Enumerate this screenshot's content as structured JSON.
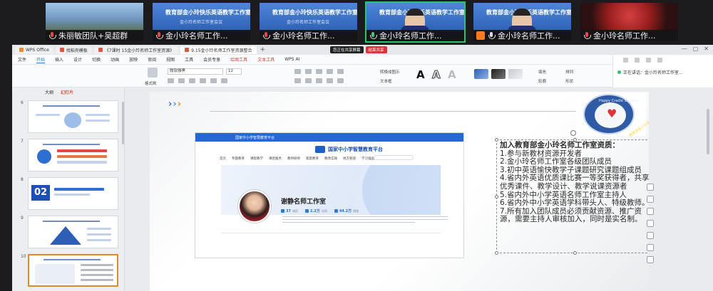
{
  "meeting": {
    "participants": [
      {
        "name": "朱丽敏团队+吴超群",
        "mic": "muted",
        "scene": "lake",
        "banner": "",
        "sub": ""
      },
      {
        "name": "金小玲名师工作...",
        "mic": "muted",
        "scene": "blue",
        "banner": "教育部金小玲快乐英语教学工作室",
        "sub": "金小玲名师工作室会议"
      },
      {
        "name": "金小玲名师工作...",
        "mic": "muted",
        "scene": "blue",
        "banner": "教育部金小玲快乐英语教学工作室",
        "sub": "金小玲名师工作室会议"
      },
      {
        "name": "金小玲名师工作...",
        "mic": "green",
        "scene": "blue",
        "banner": "教育部金小玲快乐英语教学工作室",
        "sub": "金小玲名师工作室会议"
      },
      {
        "name": "金小玲名师工作...",
        "mic": "normal",
        "scene": "blue",
        "banner": "教育部金小玲快乐英语教学工作室",
        "sub": "金小玲名师工作室会议"
      },
      {
        "name": "金小玲名师工作...",
        "mic": "muted",
        "scene": "flower",
        "banner": "",
        "sub": ""
      }
    ],
    "share_label": "您正在共享屏幕",
    "stop_label": "结束共享",
    "side_status": "正在讲话：金小玲名师工作室..."
  },
  "app": {
    "tabs": [
      {
        "label": "WPS Office",
        "kind": "o"
      },
      {
        "label": "找稻壳模板",
        "kind": "r"
      },
      {
        "label": "《7课时 15金小玲名师工作室资源》",
        "kind": "r"
      },
      {
        "label": "9.15金小玲名师工作室资源整合",
        "kind": "r"
      }
    ],
    "add_tab": "+",
    "menus": [
      "文件",
      "开始",
      "插入",
      "设计",
      "切换",
      "动画",
      "放映",
      "审阅",
      "视图",
      "工具",
      "会员专享",
      "绘图工具",
      "文本工具",
      "WPS AI"
    ],
    "active_menu": "开始",
    "ribbon": {
      "font_name": "微软雅黑",
      "font_size": "12",
      "format_painter": "格式刷",
      "convert_smartart": "转换成图示",
      "text_box": "文本框",
      "arrange": "排列",
      "shape": "形状",
      "fill": "填充",
      "outline": "轮廓"
    }
  },
  "thumbnails": {
    "header_label": "大纲",
    "header_brand": "幻灯片",
    "items": [
      {
        "num": "6"
      },
      {
        "num": "7"
      },
      {
        "num": "8"
      },
      {
        "num": "9"
      },
      {
        "num": "10"
      }
    ],
    "slide9_number": "02"
  },
  "slide": {
    "arrow_glyphs": [
      "›",
      "›",
      "›"
    ],
    "logo_ring_text": "Happy Cradle Success",
    "logo_ring_text2": "教育部金小玲名师工作室",
    "logo_heart": "♥",
    "web": {
      "site_title": "国家中小学智慧教育平台",
      "brand": "国家中小学智慧教育平台",
      "nav": [
        "首页",
        "专题教育",
        "课程教学",
        "课后服务",
        "教师研修",
        "家庭教育",
        "教改实践",
        "地方频道",
        "学习强国"
      ],
      "studio_name": "谢静名师工作室",
      "stats": [
        {
          "value": "37",
          "unit": "成员"
        },
        {
          "value": "2.2万",
          "unit": "访问"
        },
        {
          "value": "44.2万",
          "unit": "浏览"
        }
      ]
    },
    "requirements": {
      "title": "加入教育部金小玲名师工作室资质：",
      "lines": [
        "1.参与新教材资源开发者",
        "2.金小玲名师工作室各级团队成员",
        "3.初中英语愉快教学子课题研究课题组成员",
        "4.省内外英语优质课比赛一等奖获得者，共享优秀课件、教学设计、教学说课资源者",
        "5.省内外中小学英语名师工作室主持人",
        "6.省内外中小学英语学科带头人、特级教师。",
        "7.所有加入团队成员必须贡献资源、推广资源，需要主持人审核加入，同时是实名制。"
      ]
    }
  },
  "colors": {
    "accent_blue": "#2c7be5",
    "wps_red": "#e2533a",
    "active_green": "#29c46b",
    "arrow_orange": "#f08a24"
  }
}
